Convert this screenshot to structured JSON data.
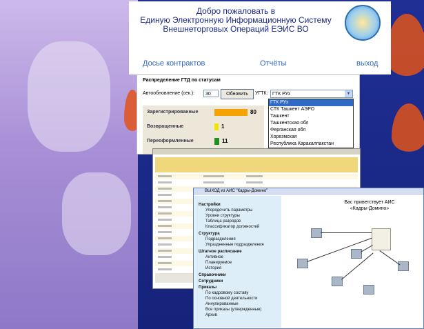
{
  "header": {
    "welcome_lines": [
      "Добро пожаловать в",
      "Единую Электронную Информационную Систему",
      "Внешнеторговых Операций ЕЭИС ВО"
    ],
    "nav": {
      "contracts": "Досье контрактов",
      "reports": "Отчёты",
      "exit": "выход"
    },
    "accent_color": "#2c66c7"
  },
  "gtd": {
    "title": "Распределение ГТД по статусам",
    "auto_refresh_label": "Автообновление (сек.):",
    "auto_refresh_value": "30",
    "refresh_button": "Обновить",
    "ugtk_label": "УГТК:",
    "ugtk_selected": "ГТК РУз",
    "statuses": [
      {
        "label": "Зарегистрированные",
        "count": "80",
        "color": "#f5a300"
      },
      {
        "label": "Возвращенные",
        "count": "1",
        "color": "#f3e400"
      },
      {
        "label": "Переоформленные",
        "count": "11",
        "color": "#1f8f1f"
      }
    ],
    "dropdown_options": [
      "ГТК РУз",
      "СТК Ташкент АЭРО",
      "Ташкент",
      "Ташкентская обл",
      "Ферганская обл",
      "Хорезмская",
      "Республика Каракалпакстан"
    ]
  },
  "hr": {
    "window_title": "ВЫХОД из АИС \"Кадры-Домино\"",
    "welcome_lines": [
      "Вас приветствует АИС",
      "«Кадры-Домино»"
    ],
    "tree": [
      {
        "label": "Настройки",
        "bold": true
      },
      {
        "label": "Упорядочить параметры",
        "bold": false
      },
      {
        "label": "Уровни структуры",
        "bold": false
      },
      {
        "label": "Таблица разрядов",
        "bold": false
      },
      {
        "label": "Классификатор должностей",
        "bold": false
      },
      {
        "label": "Структура",
        "bold": true
      },
      {
        "label": "Подразделения",
        "bold": false
      },
      {
        "label": "Упраздненные подразделения",
        "bold": false
      },
      {
        "label": "Штатное расписание",
        "bold": true
      },
      {
        "label": "Активное",
        "bold": false
      },
      {
        "label": "Планируемое",
        "bold": false
      },
      {
        "label": "История",
        "bold": false
      },
      {
        "label": "Справочники",
        "bold": true
      },
      {
        "label": "Сотрудники",
        "bold": true
      },
      {
        "label": "Приказы",
        "bold": true
      },
      {
        "label": "По кадровому составу",
        "bold": false
      },
      {
        "label": "По основной деятельности",
        "bold": false
      },
      {
        "label": "Аннулированные",
        "bold": false
      },
      {
        "label": "Все приказы (утвержденные)",
        "bold": false
      },
      {
        "label": "Архив",
        "bold": false
      }
    ]
  }
}
